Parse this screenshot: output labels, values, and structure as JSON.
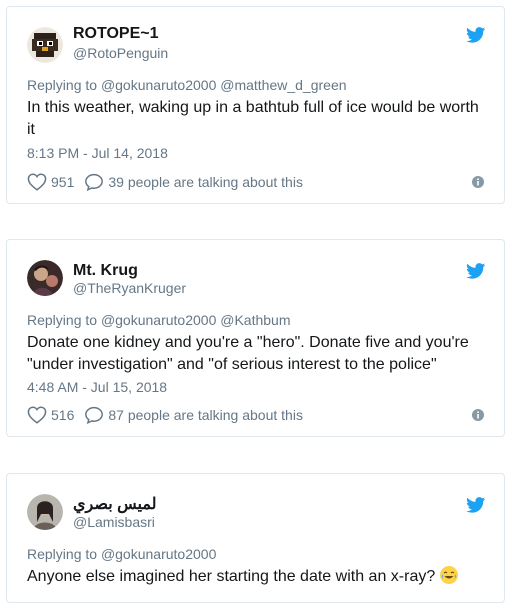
{
  "tweets": [
    {
      "name": "ROTOPE~1",
      "handle": "@RotoPenguin",
      "replying_prefix": "Replying to",
      "replying_mentions": "@gokunaruto2000 @matthew_d_green",
      "text": "In this weather, waking up in a bathtub full of ice would be worth it",
      "timestamp": "8:13 PM - Jul 14, 2018",
      "likes": "951",
      "talking": "39 people are talking about this",
      "avatar_icon": "penguin-avatar-icon"
    },
    {
      "name": "Mt. Krug",
      "handle": "@TheRyanKruger",
      "replying_prefix": "Replying to",
      "replying_mentions": "@gokunaruto2000 @Kathbum",
      "text": "Donate one kidney and you're a \"hero\". Donate five and you're \"under investigation\" and \"of serious interest to the police\"",
      "timestamp": "4:48 AM - Jul 15, 2018",
      "likes": "516",
      "talking": "87 people are talking about this",
      "avatar_icon": "person-avatar-icon"
    },
    {
      "name": "لميس بصري",
      "handle": "@Lamisbasri",
      "replying_prefix": "Replying to",
      "replying_mentions": "@gokunaruto2000",
      "text": "Anyone else imagined her starting the date with an x-ray?",
      "emoji": "tears-of-joy-emoji",
      "avatar_icon": "person-avatar-icon"
    }
  ],
  "colors": {
    "twitter_blue": "#1da1f2",
    "secondary_text": "#657786",
    "border": "#e1e8ed"
  }
}
